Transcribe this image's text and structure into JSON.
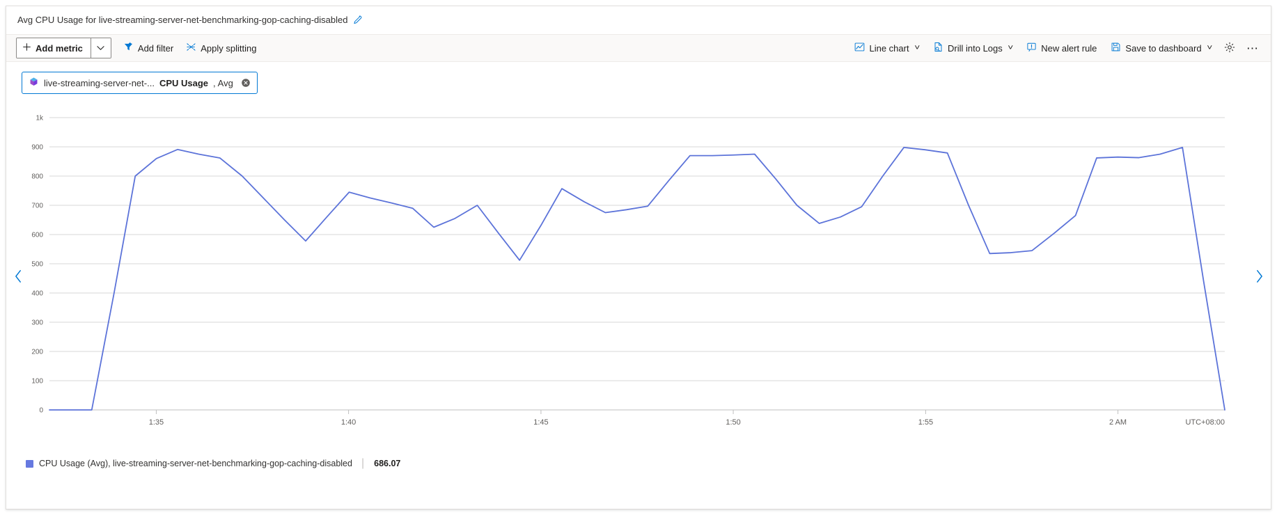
{
  "chart_title": "Avg CPU Usage for live-streaming-server-net-benchmarking-gop-caching-disabled",
  "icons": {
    "edit": "pencil-icon",
    "add": "plus-icon",
    "caret": "chevron-down-icon",
    "filter": "filter-icon",
    "splitting": "splitting-icon",
    "line_chart": "line-chart-icon",
    "logs": "drill-into-logs-icon",
    "alert": "alert-rule-icon",
    "save": "save-icon",
    "settings": "gear-icon",
    "more": "ellipsis-icon",
    "close": "close-circle-icon",
    "resource": "virtual-machine-icon",
    "prev": "chevron-left-icon",
    "next": "chevron-right-icon"
  },
  "toolbar": {
    "add_metric": "Add metric",
    "add_filter": "Add filter",
    "apply_splitting": "Apply splitting",
    "line_chart": "Line chart",
    "drill_into_logs": "Drill into Logs",
    "new_alert_rule": "New alert rule",
    "save_to_dashboard": "Save to dashboard"
  },
  "metric_pill": {
    "resource": "live-streaming-server-net-...",
    "metric": "CPU Usage",
    "aggregation_separator": ",",
    "aggregation": "Avg"
  },
  "legend": {
    "label": "CPU Usage (Avg), live-streaming-server-net-benchmarking-gop-caching-disabled",
    "value": "686.07",
    "color": "#6679e0"
  },
  "chart_data": {
    "type": "line",
    "title": "Avg CPU Usage for live-streaming-server-net-benchmarking-gop-caching-disabled",
    "xlabel": "",
    "ylabel": "",
    "timezone": "UTC+08:00",
    "grid": true,
    "legend_position": "bottom-left",
    "series_color": "#5c73d9",
    "ylim": [
      0,
      1000
    ],
    "ytick_values": [
      0,
      100,
      200,
      300,
      400,
      500,
      600,
      700,
      800,
      900,
      1000
    ],
    "ytick_labels": [
      "0",
      "100",
      "200",
      "300",
      "400",
      "500",
      "600",
      "700",
      "800",
      "900",
      "1k"
    ],
    "xtick_labels": [
      "1:35",
      "1:40",
      "1:45",
      "1:50",
      "1:55",
      "2 AM"
    ],
    "xtick_positions": [
      0.0909,
      0.2545,
      0.4182,
      0.5818,
      0.7455,
      0.9091
    ],
    "xlim_labels": [
      "1:33",
      "2:03"
    ],
    "series": [
      {
        "name": "CPU Usage (Avg), live-streaming-server-net-benchmarking-gop-caching-disabled",
        "x": [
          0.0,
          0.018,
          0.036,
          0.055,
          0.073,
          0.091,
          0.109,
          0.127,
          0.145,
          0.164,
          0.182,
          0.2,
          0.218,
          0.236,
          0.255,
          0.273,
          0.291,
          0.309,
          0.327,
          0.345,
          0.364,
          0.382,
          0.4,
          0.418,
          0.436,
          0.455,
          0.473,
          0.491,
          0.509,
          0.527,
          0.545,
          0.564,
          0.582,
          0.6,
          0.618,
          0.636,
          0.655,
          0.673,
          0.691,
          0.709,
          0.727,
          0.745,
          0.764,
          0.782,
          0.8,
          0.818,
          0.836,
          0.855,
          0.873,
          0.891,
          0.909,
          0.927,
          0.945,
          0.964,
          0.982,
          1.0
        ],
        "values": [
          0,
          0,
          0,
          400,
          800,
          860,
          891,
          875,
          862,
          800,
          725,
          650,
          578,
          660,
          745,
          725,
          708,
          690,
          625,
          655,
          700,
          605,
          512,
          630,
          757,
          712,
          675,
          685,
          697,
          785,
          870,
          870,
          872,
          875,
          790,
          700,
          638,
          660,
          695,
          800,
          898,
          890,
          879,
          700,
          535,
          538,
          545,
          605,
          665,
          862,
          865,
          863,
          875,
          898,
          440,
          0
        ]
      }
    ]
  }
}
